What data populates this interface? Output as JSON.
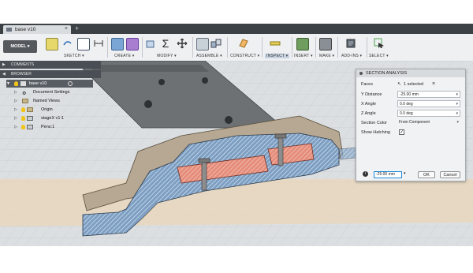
{
  "tab": {
    "title": "base v10",
    "close": "×",
    "add": "+"
  },
  "toolbar": {
    "workspace": "MODEL ▾",
    "groups": [
      "SKETCH ▾",
      "CREATE ▾",
      "MODIFY ▾",
      "ASSEMBLE ▾",
      "CONSTRUCT ▾",
      "INSPECT ▾",
      "INSERT ▾",
      "MAKE ▾",
      "ADD-INS ▾",
      "SELECT ▾"
    ]
  },
  "panels": {
    "comments": "COMMENTS",
    "browser": "BROWSER"
  },
  "browser": {
    "root": "base v10",
    "items": [
      "Document Settings",
      "Named Views",
      "Origin",
      "stageX v1:1",
      "Pens:1"
    ]
  },
  "dialog": {
    "title": "SECTION ANALYSIS",
    "rows": [
      {
        "label": "Faces",
        "value": "1 selected"
      },
      {
        "label": "Y Distance",
        "value": "-25.00 mm"
      },
      {
        "label": "X Angle",
        "value": "0.0 deg"
      },
      {
        "label": "Z Angle",
        "value": "0.0 deg"
      },
      {
        "label": "Section Color",
        "value": "From Component"
      },
      {
        "label": "Show Hatching",
        "value": ""
      }
    ],
    "distance_input": "-25.00 mm",
    "ok_label": "OK",
    "cancel_label": "Cancel",
    "hatching_checked": "✓",
    "clear_selection": "×"
  },
  "colors": {
    "part_hatch": "#7d9fc3",
    "part_section": "#e58c7a",
    "part_surface": "#b6a892",
    "accent": "#1e8ad6"
  }
}
